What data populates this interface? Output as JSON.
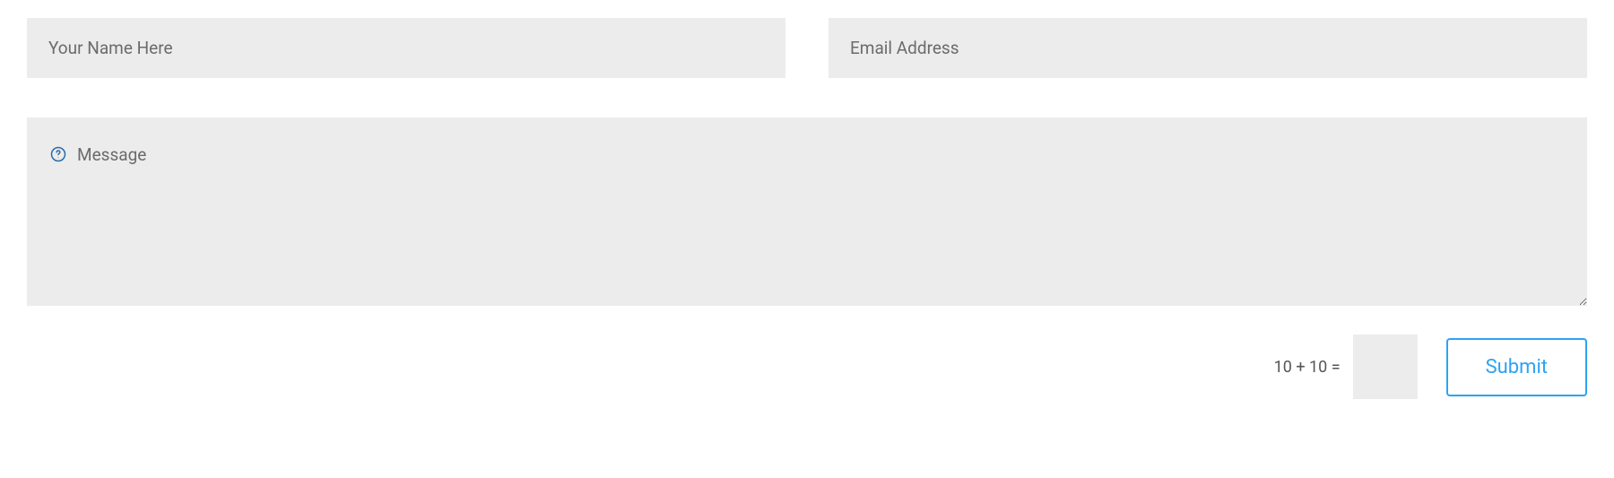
{
  "form": {
    "name_placeholder": "Your Name Here",
    "email_placeholder": "Email Address",
    "message_placeholder": "Message",
    "captcha_question": "10 + 10 =",
    "submit_label": "Submit"
  },
  "colors": {
    "input_bg": "#ececec",
    "accent": "#2ea3f2",
    "placeholder": "#6b6b6b"
  }
}
